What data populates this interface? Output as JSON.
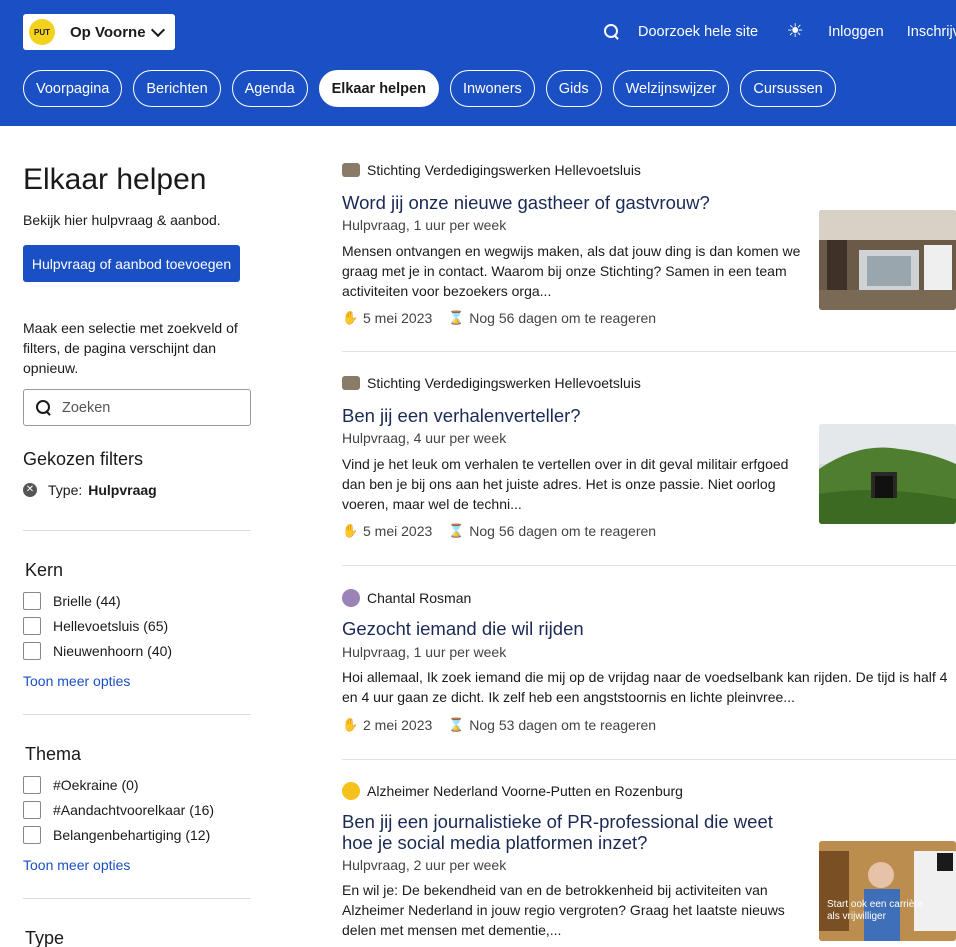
{
  "header": {
    "site_name": "Op Voorne",
    "logo_text": "PUT",
    "search_label": "Doorzoek hele site",
    "login": "Inloggen",
    "signup": "Inschrijven",
    "nav": [
      "Voorpagina",
      "Berichten",
      "Agenda",
      "Elkaar helpen",
      "Inwoners",
      "Gids",
      "Welzijnswijzer",
      "Cursussen"
    ],
    "active_nav": "Elkaar helpen"
  },
  "sidebar": {
    "title": "Elkaar helpen",
    "intro": "Bekijk hier hulpvraag & aanbod.",
    "add_button": "Hulpvraag of aanbod toevoegen",
    "filter_help": "Maak een selectie met zoekveld of filters, de pagina verschijnt dan opnieuw.",
    "search_placeholder": "Zoeken",
    "chosen_heading": "Gekozen filters",
    "chosen_label": "Type:",
    "chosen_value": "Hulpvraag",
    "kern": {
      "heading": "Kern",
      "options": [
        "Brielle (44)",
        "Hellevoetsluis (65)",
        "Nieuwenhoorn (40)"
      ],
      "more": "Toon meer opties"
    },
    "thema": {
      "heading": "Thema",
      "options": [
        "#Oekraine (0)",
        "#Aandachtvoorelkaar (16)",
        "Belangenbehartiging (12)"
      ],
      "more": "Toon meer opties"
    },
    "type_heading": "Type"
  },
  "cards": [
    {
      "org": "Stichting Verdedigingswerken Hellevoetsluis",
      "title": "Word jij onze nieuwe gastheer of gastvrouw?",
      "meta": "Hulpvraag, 1 uur per week",
      "desc": "Mensen ontvangen en wegwijs maken, als dat jouw ding is dan komen we graag met je in contact. Waarom bij onze Stichting? Samen in een team activiteiten voor bezoekers orga...",
      "date": "5 mei 2023",
      "remaining": "Nog 56 dagen om te reageren"
    },
    {
      "org": "Stichting Verdedigingswerken Hellevoetsluis",
      "title": "Ben jij een verhalenverteller?",
      "meta": "Hulpvraag, 4 uur per week",
      "desc": "Vind je het leuk om verhalen te vertellen over in dit geval militair erfgoed dan ben je bij ons aan het juiste adres. Het is onze passie. Niet oorlog voeren, maar wel de techni...",
      "date": "5 mei 2023",
      "remaining": "Nog 56 dagen om te reageren"
    },
    {
      "org": "Chantal Rosman",
      "title": "Gezocht iemand die wil rijden",
      "meta": "Hulpvraag, 1 uur per week",
      "desc": "Hoi allemaal, Ik zoek iemand die mij op de vrijdag naar de voedselbank kan rijden. De tijd is half 4 en 4 uur gaan ze dicht. Ik zelf heb een angststoornis en lichte pleinvree...",
      "date": "2 mei 2023",
      "remaining": "Nog 53 dagen om te reageren"
    },
    {
      "org": "Alzheimer Nederland Voorne-Putten en Rozenburg",
      "title": "Ben jij een journalistieke of PR-professional die weet hoe je social media platformen inzet?",
      "meta": "Hulpvraag, 2 uur per week",
      "desc": "En wil je: De bekendheid van en de betrokkenheid bij activiteiten van Alzheimer Nederland in jouw regio vergroten? Graag het laatste nieuws delen met mensen met dementie,...",
      "thumb_text": "Start ook een carrière als vrijwilliger"
    }
  ]
}
